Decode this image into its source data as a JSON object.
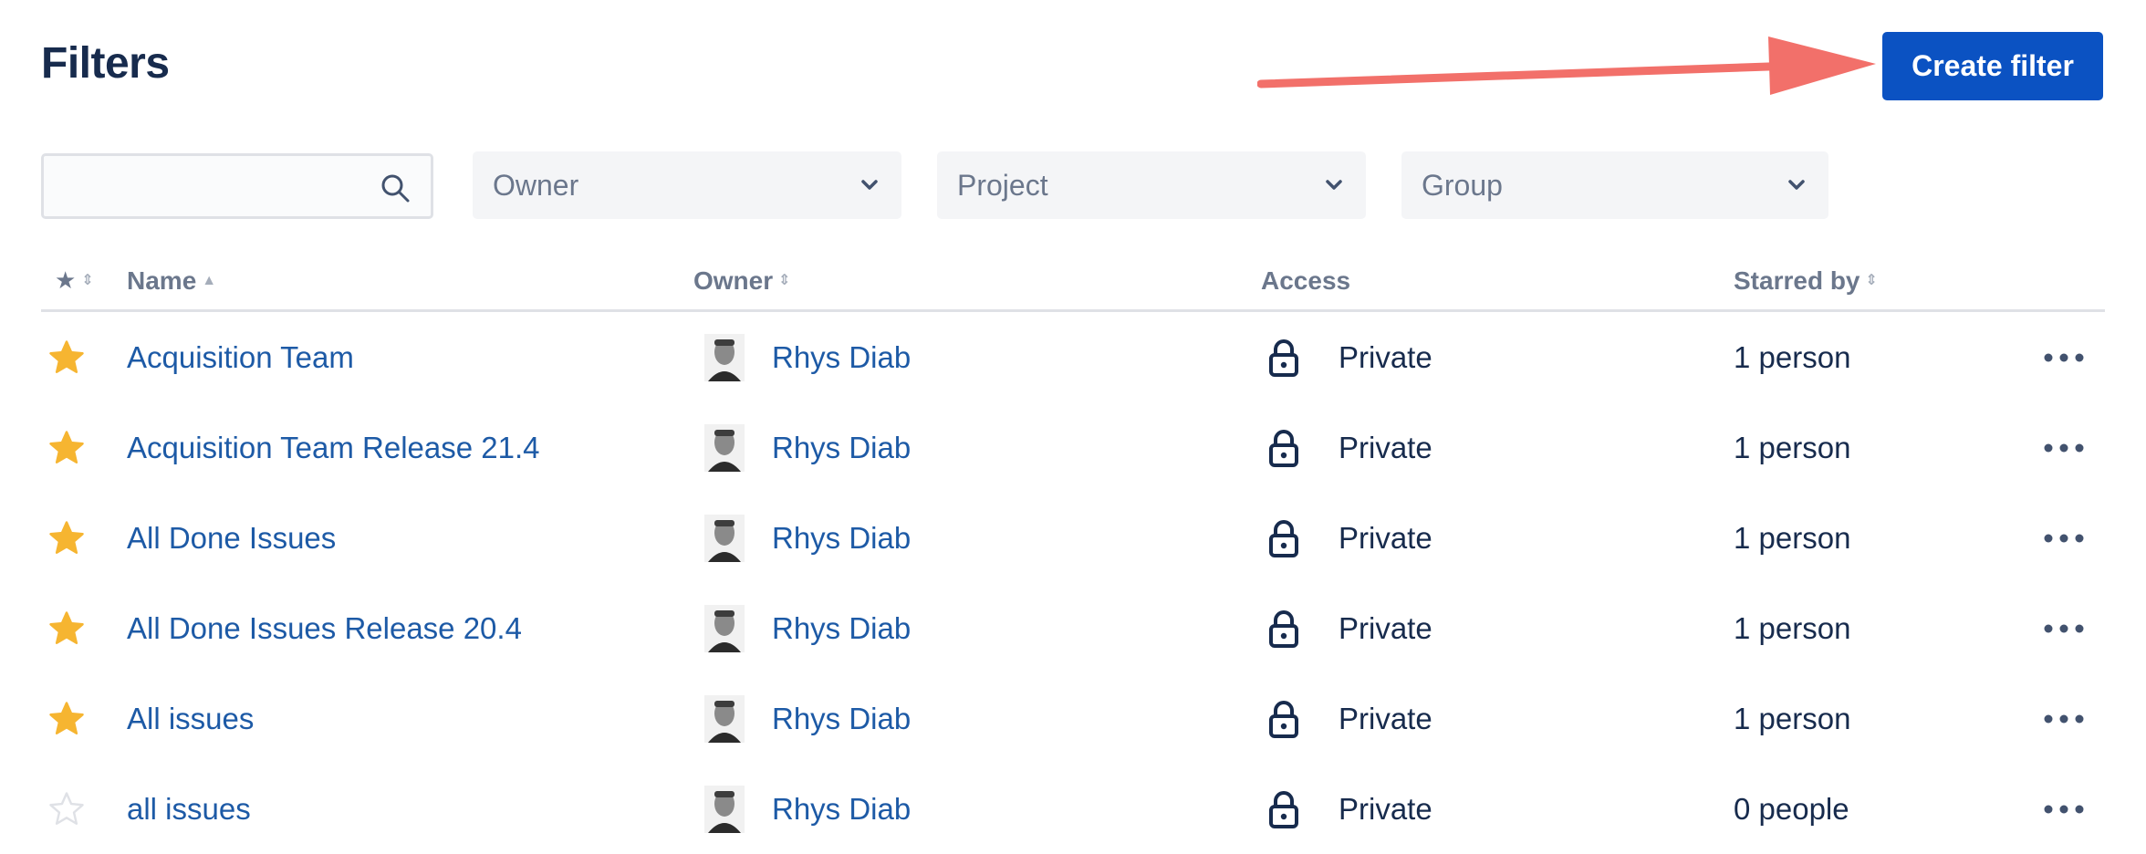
{
  "page": {
    "title": "Filters"
  },
  "toolbar": {
    "create_label": "Create filter"
  },
  "search": {
    "value": "",
    "placeholder": ""
  },
  "filters": {
    "owner_label": "Owner",
    "project_label": "Project",
    "group_label": "Group"
  },
  "table": {
    "headers": {
      "star": "★",
      "name": "Name",
      "owner": "Owner",
      "access": "Access",
      "starred_by": "Starred by"
    },
    "rows": [
      {
        "starred": true,
        "name": "Acquisition Team",
        "owner": "Rhys Diab",
        "access": "Private",
        "starred_by": "1 person"
      },
      {
        "starred": true,
        "name": "Acquisition Team Release 21.4",
        "owner": "Rhys Diab",
        "access": "Private",
        "starred_by": "1 person"
      },
      {
        "starred": true,
        "name": "All Done Issues",
        "owner": "Rhys Diab",
        "access": "Private",
        "starred_by": "1 person"
      },
      {
        "starred": true,
        "name": "All Done Issues Release 20.4",
        "owner": "Rhys Diab",
        "access": "Private",
        "starred_by": "1 person"
      },
      {
        "starred": true,
        "name": "All issues",
        "owner": "Rhys Diab",
        "access": "Private",
        "starred_by": "1 person"
      },
      {
        "starred": false,
        "name": "all issues",
        "owner": "Rhys Diab",
        "access": "Private",
        "starred_by": "0 people"
      }
    ]
  },
  "icons": {
    "search": "search-icon",
    "chevron": "chevron-down-icon",
    "star": "star-icon",
    "lock": "lock-icon",
    "more": "more-icon",
    "arrow": "arrow-annotation"
  },
  "colors": {
    "primary": "#0b52c2",
    "link": "#1d5aa6",
    "star_filled": "#f6b531",
    "star_empty": "#dfe1e6",
    "arrow": "#f2706a",
    "muted": "#6b778c"
  }
}
